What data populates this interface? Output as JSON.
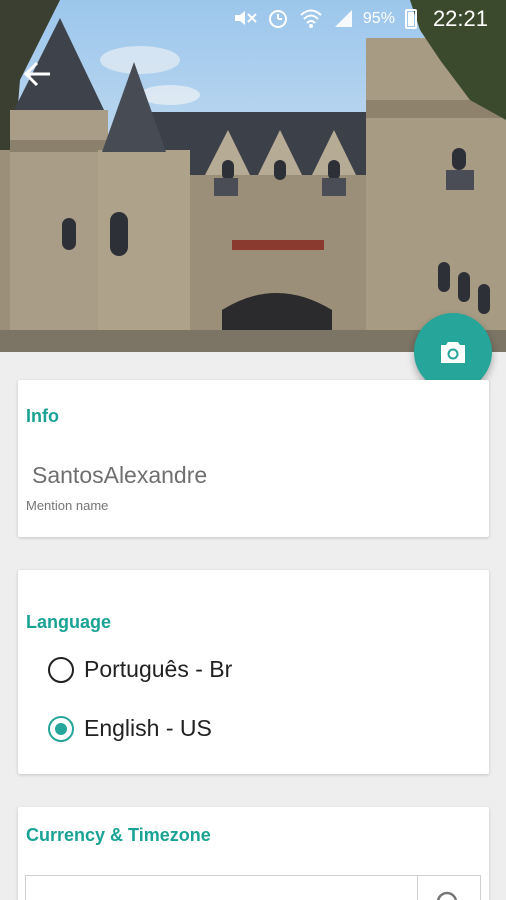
{
  "status_bar": {
    "icons": [
      "mute-icon",
      "alarm-icon",
      "wifi-icon",
      "signal-icon"
    ],
    "battery_percent": "95%",
    "time": "22:21"
  },
  "header": {
    "back_icon": "arrow-left-icon",
    "camera_icon": "camera-icon"
  },
  "info": {
    "title": "Info",
    "mention_value": "SantosAlexandre",
    "mention_label": "Mention name"
  },
  "language": {
    "title": "Language",
    "options": [
      {
        "label": "Português - Br",
        "selected": false
      },
      {
        "label": "English - US",
        "selected": true
      }
    ]
  },
  "currency": {
    "title": "Currency & Timezone",
    "search_icon": "search-icon"
  },
  "colors": {
    "accent": "#26a69a",
    "title_teal": "#1aa394"
  }
}
